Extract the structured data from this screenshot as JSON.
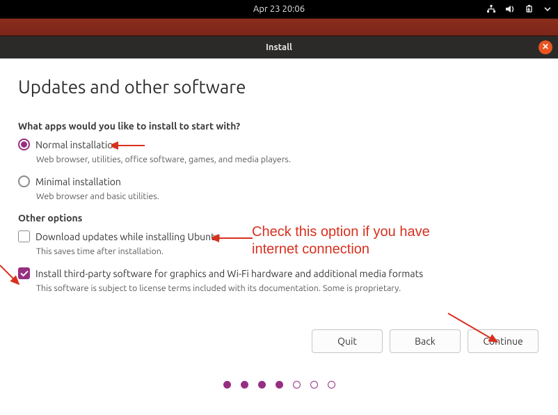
{
  "topbar": {
    "datetime": "Apr 23  20:06"
  },
  "titlebar": {
    "title": "Install"
  },
  "page": {
    "heading": "Updates and other software",
    "q1": "What apps would you like to install to start with?",
    "normal": {
      "label": "Normal installation",
      "desc": "Web browser, utilities, office software, games, and media players."
    },
    "minimal": {
      "label": "Minimal installation",
      "desc": "Web browser and basic utilities."
    },
    "other_heading": "Other options",
    "download": {
      "label": "Download updates while installing Ubuntu",
      "desc": "This saves time after installation."
    },
    "third_party": {
      "label": "Install third-party software for graphics and Wi-Fi hardware and additional media formats",
      "desc": "This software is subject to license terms included with its documentation. Some is proprietary."
    }
  },
  "buttons": {
    "quit": "Quit",
    "back": "Back",
    "continue": "Continue"
  },
  "annotations": {
    "internet": "Check this option if you have\ninternet connection"
  }
}
